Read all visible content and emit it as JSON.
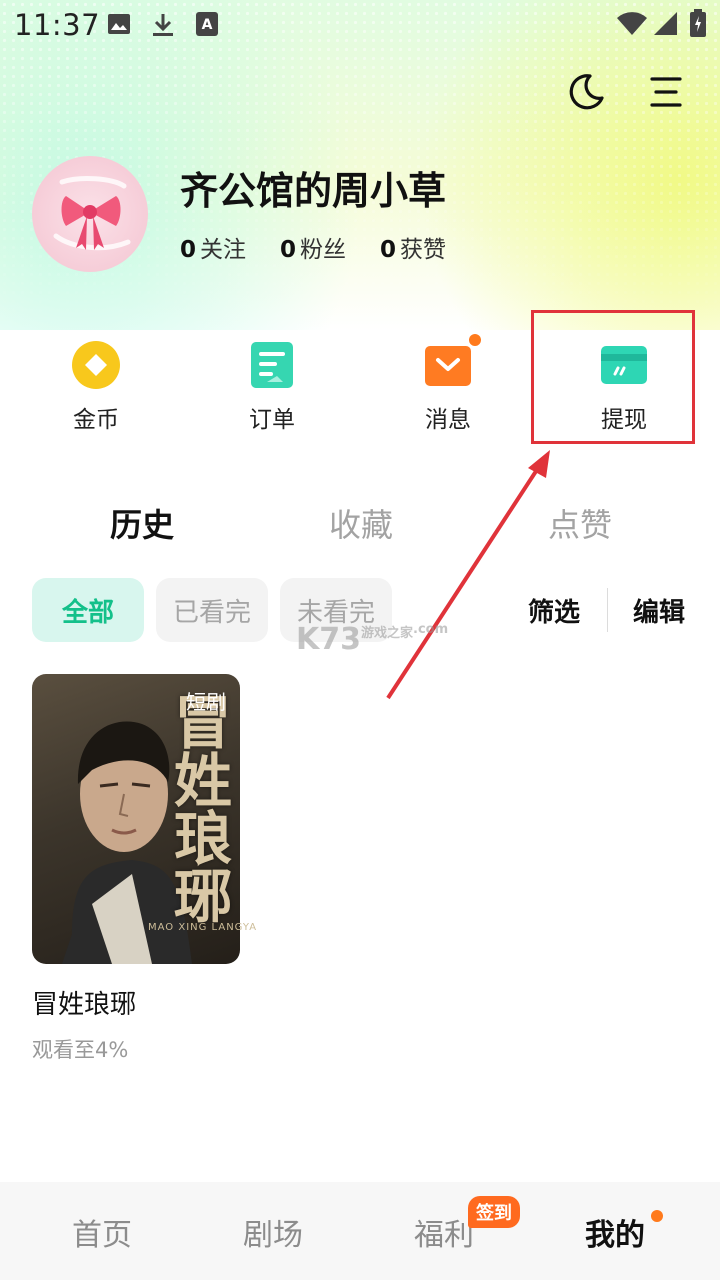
{
  "status_bar": {
    "time": "11:37",
    "icons": [
      "image-icon",
      "download-icon",
      "a-badge-icon",
      "wifi-icon",
      "signal-icon",
      "battery-icon"
    ]
  },
  "header": {
    "icons": [
      "moon-icon",
      "menu-icon"
    ]
  },
  "profile": {
    "username": "齐公馆的周小草",
    "stats": [
      {
        "count": "0",
        "label": "关注"
      },
      {
        "count": "0",
        "label": "粉丝"
      },
      {
        "count": "0",
        "label": "获赞"
      }
    ]
  },
  "quick_actions": [
    {
      "label": "金币",
      "icon": "coin-icon",
      "color": "#f8c81c"
    },
    {
      "label": "订单",
      "icon": "order-icon",
      "color": "#36d6b1"
    },
    {
      "label": "消息",
      "icon": "message-icon",
      "color": "#ff7b22"
    },
    {
      "label": "提现",
      "icon": "withdraw-card-icon",
      "color": "#2ed6b4"
    }
  ],
  "tabs": [
    {
      "label": "历史",
      "active": true
    },
    {
      "label": "收藏",
      "active": false
    },
    {
      "label": "点赞",
      "active": false
    }
  ],
  "filters": {
    "chips": [
      {
        "label": "全部",
        "active": true
      },
      {
        "label": "已看完",
        "active": false
      },
      {
        "label": "未看完",
        "active": false
      }
    ],
    "filter_label": "筛选",
    "edit_label": "编辑"
  },
  "history_items": [
    {
      "badge": "短剧",
      "poster_title": "冒姓琅琊",
      "poster_subtitle": "MAO XING LANGYA",
      "title": "冒姓琅琊",
      "progress": "观看至4%"
    }
  ],
  "watermark": {
    "main": "K73",
    "sub": "游戏之家",
    "domain": ".com"
  },
  "bottom_nav": [
    {
      "label": "首页",
      "active": false
    },
    {
      "label": "剧场",
      "active": false
    },
    {
      "label": "福利",
      "active": false,
      "badge": "签到"
    },
    {
      "label": "我的",
      "active": true
    }
  ],
  "colors": {
    "accent": "#14c08a",
    "highlight_box": "#e0333a",
    "notification_dot": "#ff7a1c"
  }
}
